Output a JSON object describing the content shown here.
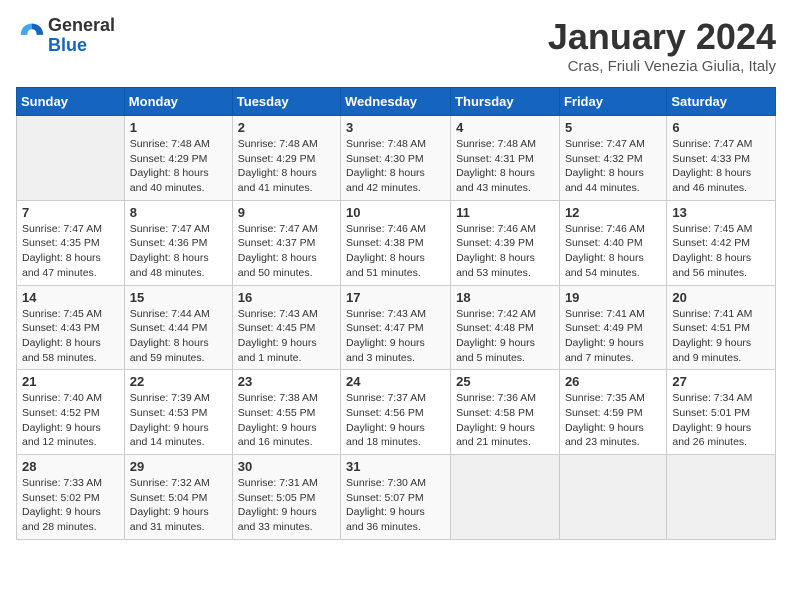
{
  "header": {
    "logo_general": "General",
    "logo_blue": "Blue",
    "month_title": "January 2024",
    "location": "Cras, Friuli Venezia Giulia, Italy"
  },
  "days_of_week": [
    "Sunday",
    "Monday",
    "Tuesday",
    "Wednesday",
    "Thursday",
    "Friday",
    "Saturday"
  ],
  "weeks": [
    [
      {
        "day": null,
        "sunrise": null,
        "sunset": null,
        "daylight": null
      },
      {
        "day": "1",
        "sunrise": "Sunrise: 7:48 AM",
        "sunset": "Sunset: 4:29 PM",
        "daylight": "Daylight: 8 hours and 40 minutes."
      },
      {
        "day": "2",
        "sunrise": "Sunrise: 7:48 AM",
        "sunset": "Sunset: 4:29 PM",
        "daylight": "Daylight: 8 hours and 41 minutes."
      },
      {
        "day": "3",
        "sunrise": "Sunrise: 7:48 AM",
        "sunset": "Sunset: 4:30 PM",
        "daylight": "Daylight: 8 hours and 42 minutes."
      },
      {
        "day": "4",
        "sunrise": "Sunrise: 7:48 AM",
        "sunset": "Sunset: 4:31 PM",
        "daylight": "Daylight: 8 hours and 43 minutes."
      },
      {
        "day": "5",
        "sunrise": "Sunrise: 7:47 AM",
        "sunset": "Sunset: 4:32 PM",
        "daylight": "Daylight: 8 hours and 44 minutes."
      },
      {
        "day": "6",
        "sunrise": "Sunrise: 7:47 AM",
        "sunset": "Sunset: 4:33 PM",
        "daylight": "Daylight: 8 hours and 46 minutes."
      }
    ],
    [
      {
        "day": "7",
        "sunrise": "Sunrise: 7:47 AM",
        "sunset": "Sunset: 4:35 PM",
        "daylight": "Daylight: 8 hours and 47 minutes."
      },
      {
        "day": "8",
        "sunrise": "Sunrise: 7:47 AM",
        "sunset": "Sunset: 4:36 PM",
        "daylight": "Daylight: 8 hours and 48 minutes."
      },
      {
        "day": "9",
        "sunrise": "Sunrise: 7:47 AM",
        "sunset": "Sunset: 4:37 PM",
        "daylight": "Daylight: 8 hours and 50 minutes."
      },
      {
        "day": "10",
        "sunrise": "Sunrise: 7:46 AM",
        "sunset": "Sunset: 4:38 PM",
        "daylight": "Daylight: 8 hours and 51 minutes."
      },
      {
        "day": "11",
        "sunrise": "Sunrise: 7:46 AM",
        "sunset": "Sunset: 4:39 PM",
        "daylight": "Daylight: 8 hours and 53 minutes."
      },
      {
        "day": "12",
        "sunrise": "Sunrise: 7:46 AM",
        "sunset": "Sunset: 4:40 PM",
        "daylight": "Daylight: 8 hours and 54 minutes."
      },
      {
        "day": "13",
        "sunrise": "Sunrise: 7:45 AM",
        "sunset": "Sunset: 4:42 PM",
        "daylight": "Daylight: 8 hours and 56 minutes."
      }
    ],
    [
      {
        "day": "14",
        "sunrise": "Sunrise: 7:45 AM",
        "sunset": "Sunset: 4:43 PM",
        "daylight": "Daylight: 8 hours and 58 minutes."
      },
      {
        "day": "15",
        "sunrise": "Sunrise: 7:44 AM",
        "sunset": "Sunset: 4:44 PM",
        "daylight": "Daylight: 8 hours and 59 minutes."
      },
      {
        "day": "16",
        "sunrise": "Sunrise: 7:43 AM",
        "sunset": "Sunset: 4:45 PM",
        "daylight": "Daylight: 9 hours and 1 minute."
      },
      {
        "day": "17",
        "sunrise": "Sunrise: 7:43 AM",
        "sunset": "Sunset: 4:47 PM",
        "daylight": "Daylight: 9 hours and 3 minutes."
      },
      {
        "day": "18",
        "sunrise": "Sunrise: 7:42 AM",
        "sunset": "Sunset: 4:48 PM",
        "daylight": "Daylight: 9 hours and 5 minutes."
      },
      {
        "day": "19",
        "sunrise": "Sunrise: 7:41 AM",
        "sunset": "Sunset: 4:49 PM",
        "daylight": "Daylight: 9 hours and 7 minutes."
      },
      {
        "day": "20",
        "sunrise": "Sunrise: 7:41 AM",
        "sunset": "Sunset: 4:51 PM",
        "daylight": "Daylight: 9 hours and 9 minutes."
      }
    ],
    [
      {
        "day": "21",
        "sunrise": "Sunrise: 7:40 AM",
        "sunset": "Sunset: 4:52 PM",
        "daylight": "Daylight: 9 hours and 12 minutes."
      },
      {
        "day": "22",
        "sunrise": "Sunrise: 7:39 AM",
        "sunset": "Sunset: 4:53 PM",
        "daylight": "Daylight: 9 hours and 14 minutes."
      },
      {
        "day": "23",
        "sunrise": "Sunrise: 7:38 AM",
        "sunset": "Sunset: 4:55 PM",
        "daylight": "Daylight: 9 hours and 16 minutes."
      },
      {
        "day": "24",
        "sunrise": "Sunrise: 7:37 AM",
        "sunset": "Sunset: 4:56 PM",
        "daylight": "Daylight: 9 hours and 18 minutes."
      },
      {
        "day": "25",
        "sunrise": "Sunrise: 7:36 AM",
        "sunset": "Sunset: 4:58 PM",
        "daylight": "Daylight: 9 hours and 21 minutes."
      },
      {
        "day": "26",
        "sunrise": "Sunrise: 7:35 AM",
        "sunset": "Sunset: 4:59 PM",
        "daylight": "Daylight: 9 hours and 23 minutes."
      },
      {
        "day": "27",
        "sunrise": "Sunrise: 7:34 AM",
        "sunset": "Sunset: 5:01 PM",
        "daylight": "Daylight: 9 hours and 26 minutes."
      }
    ],
    [
      {
        "day": "28",
        "sunrise": "Sunrise: 7:33 AM",
        "sunset": "Sunset: 5:02 PM",
        "daylight": "Daylight: 9 hours and 28 minutes."
      },
      {
        "day": "29",
        "sunrise": "Sunrise: 7:32 AM",
        "sunset": "Sunset: 5:04 PM",
        "daylight": "Daylight: 9 hours and 31 minutes."
      },
      {
        "day": "30",
        "sunrise": "Sunrise: 7:31 AM",
        "sunset": "Sunset: 5:05 PM",
        "daylight": "Daylight: 9 hours and 33 minutes."
      },
      {
        "day": "31",
        "sunrise": "Sunrise: 7:30 AM",
        "sunset": "Sunset: 5:07 PM",
        "daylight": "Daylight: 9 hours and 36 minutes."
      },
      {
        "day": null,
        "sunrise": null,
        "sunset": null,
        "daylight": null
      },
      {
        "day": null,
        "sunrise": null,
        "sunset": null,
        "daylight": null
      },
      {
        "day": null,
        "sunrise": null,
        "sunset": null,
        "daylight": null
      }
    ]
  ]
}
